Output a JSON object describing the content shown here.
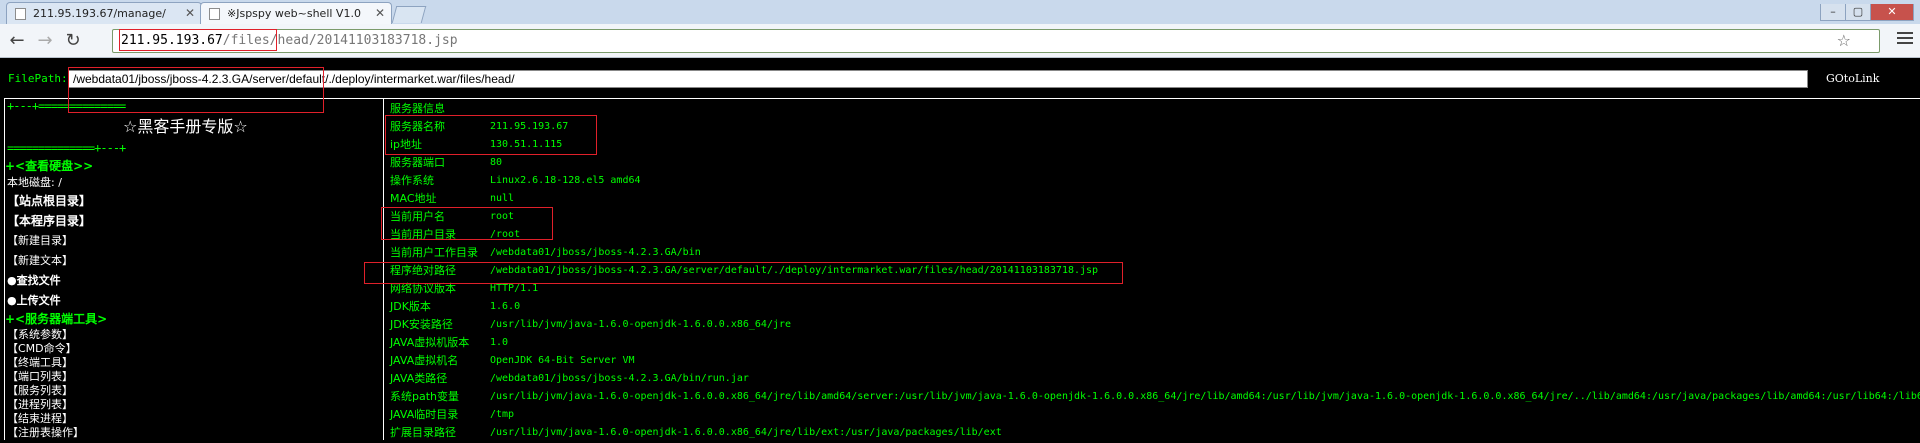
{
  "browser": {
    "tabs": [
      {
        "title": "211.95.193.67/manage/",
        "active": false
      },
      {
        "title": "※Jspspy web~shell V1.0",
        "active": true
      }
    ],
    "window_controls": {
      "minimize": "–",
      "maximize": "▢",
      "close": "✕"
    },
    "address_bar": {
      "host": "211.95.193.67",
      "path": "/files/head/20141103183718.jsp"
    },
    "icons": {
      "back": "arrow-left-icon",
      "forward": "arrow-right-icon",
      "reload": "reload-icon",
      "bookmark": "star-icon",
      "menu": "menu-icon"
    }
  },
  "shell": {
    "filepath_label": "FilePath:",
    "filepath_value": "/webdata01/jboss/jboss-4.2.3.GA/server/default/./deploy/intermarket.war/files/head/",
    "goto_label": "GOtoLink",
    "sidebar": {
      "sep_top": "+---+==============",
      "title": "☆黑客手册专版☆",
      "sep_bottom": "==============+---+",
      "disk_header": "+<查看硬盘>>",
      "local_disk": "本地磁盘: /",
      "site_root": "【站点根目录】",
      "program_dir": "【本程序目录】",
      "new_dir": "【新建目录】",
      "new_text": "【新建文本】",
      "find_file": "●查找文件",
      "upload_file": "●上传文件",
      "tools_header": "+<服务器端工具>",
      "tools": [
        "【系统参数】",
        "【CMD命令】",
        "【终端工具】",
        "【端口列表】",
        "【服务列表】",
        "【进程列表】",
        "【结束进程】",
        "【注册表操作】"
      ]
    },
    "server_info": {
      "header": "服务器信息",
      "rows": [
        {
          "key": "服务器名称",
          "value": "211.95.193.67"
        },
        {
          "key": "ip地址",
          "value": "130.51.1.115"
        },
        {
          "key": "服务器端口",
          "value": "80"
        },
        {
          "key": "操作系统",
          "value": "Linux2.6.18-128.el5 amd64"
        },
        {
          "key": "MAC地址",
          "value": "null"
        },
        {
          "key": "当前用户名",
          "value": "root"
        },
        {
          "key": "当前用户目录",
          "value": "/root"
        },
        {
          "key": "当前用户工作目录",
          "value": "/webdata01/jboss/jboss-4.2.3.GA/bin"
        },
        {
          "key": "程序绝对路径",
          "value": "/webdata01/jboss/jboss-4.2.3.GA/server/default/./deploy/intermarket.war/files/head/20141103183718.jsp"
        },
        {
          "key": "网络协议版本",
          "value": "HTTP/1.1"
        },
        {
          "key": "JDK版本",
          "value": "1.6.0"
        },
        {
          "key": "JDK安装路径",
          "value": "/usr/lib/jvm/java-1.6.0-openjdk-1.6.0.0.x86_64/jre"
        },
        {
          "key": "JAVA虚拟机版本",
          "value": "1.0"
        },
        {
          "key": "JAVA虚拟机名",
          "value": "OpenJDK 64-Bit Server VM"
        },
        {
          "key": "JAVA类路径",
          "value": "/webdata01/jboss/jboss-4.2.3.GA/bin/run.jar"
        },
        {
          "key": "系统path变量",
          "value": "/usr/lib/jvm/java-1.6.0-openjdk-1.6.0.0.x86_64/jre/lib/amd64/server:/usr/lib/jvm/java-1.6.0-openjdk-1.6.0.0.x86_64/jre/lib/amd64:/usr/lib/jvm/java-1.6.0-openjdk-1.6.0.0.x86_64/jre/../lib/amd64:/usr/java/packages/lib/amd64:/usr/lib64:/lib6"
        },
        {
          "key": "JAVA临时目录",
          "value": "/tmp"
        },
        {
          "key": "扩展目录路径",
          "value": "/usr/lib/jvm/java-1.6.0-openjdk-1.6.0.0.x86_64/jre/lib/ext:/usr/java/packages/lib/ext"
        }
      ]
    }
  },
  "colors": {
    "highlight": "#e0202a",
    "terminal_green": "#00ff00",
    "background": "#000000"
  }
}
